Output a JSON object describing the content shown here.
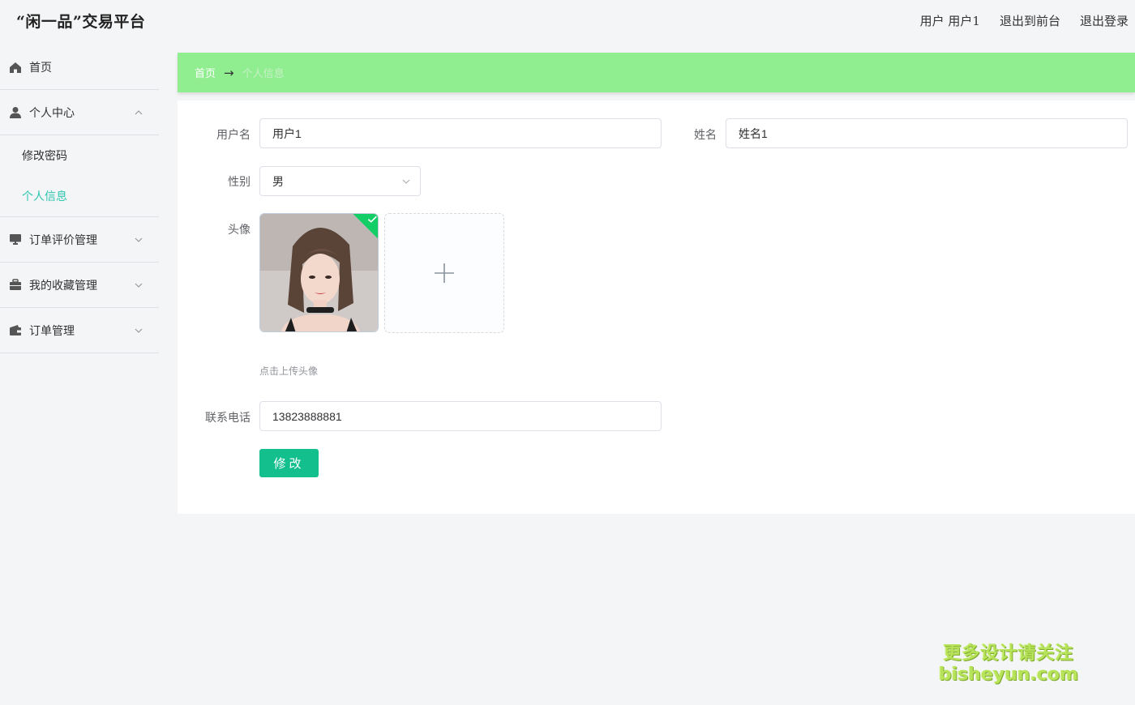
{
  "app": {
    "title": "“闲一品”交易平台"
  },
  "header": {
    "user_label": "用户 用户1",
    "to_front": "退出到前台",
    "logout": "退出登录"
  },
  "sidebar": {
    "items": [
      {
        "label": "首页",
        "icon": "home-icon"
      },
      {
        "label": "个人中心",
        "icon": "user-icon",
        "expanded": true,
        "children": [
          {
            "label": "修改密码"
          },
          {
            "label": "个人信息",
            "active": true
          }
        ]
      },
      {
        "label": "订单评价管理",
        "icon": "monitor-icon"
      },
      {
        "label": "我的收藏管理",
        "icon": "briefcase-icon"
      },
      {
        "label": "订单管理",
        "icon": "wallet-icon"
      }
    ]
  },
  "breadcrumb": {
    "home": "首页",
    "separator": "→",
    "current": "个人信息"
  },
  "form": {
    "username": {
      "label": "用户名",
      "value": "用户1"
    },
    "name": {
      "label": "姓名",
      "value": "姓名1"
    },
    "gender": {
      "label": "性别",
      "value": "男"
    },
    "avatar": {
      "label": "头像",
      "upload_tip": "点击上传头像"
    },
    "phone": {
      "label": "联系电话",
      "value": "13823888881"
    },
    "submit_label": "修改"
  },
  "watermark": {
    "line1": "更多设计请关注",
    "line2": "bisheyun.com"
  },
  "colors": {
    "accent": "#2fc5b0",
    "breadcrumb_bg": "#90ee90",
    "button": "#14bf8e",
    "success": "#13ce66"
  }
}
